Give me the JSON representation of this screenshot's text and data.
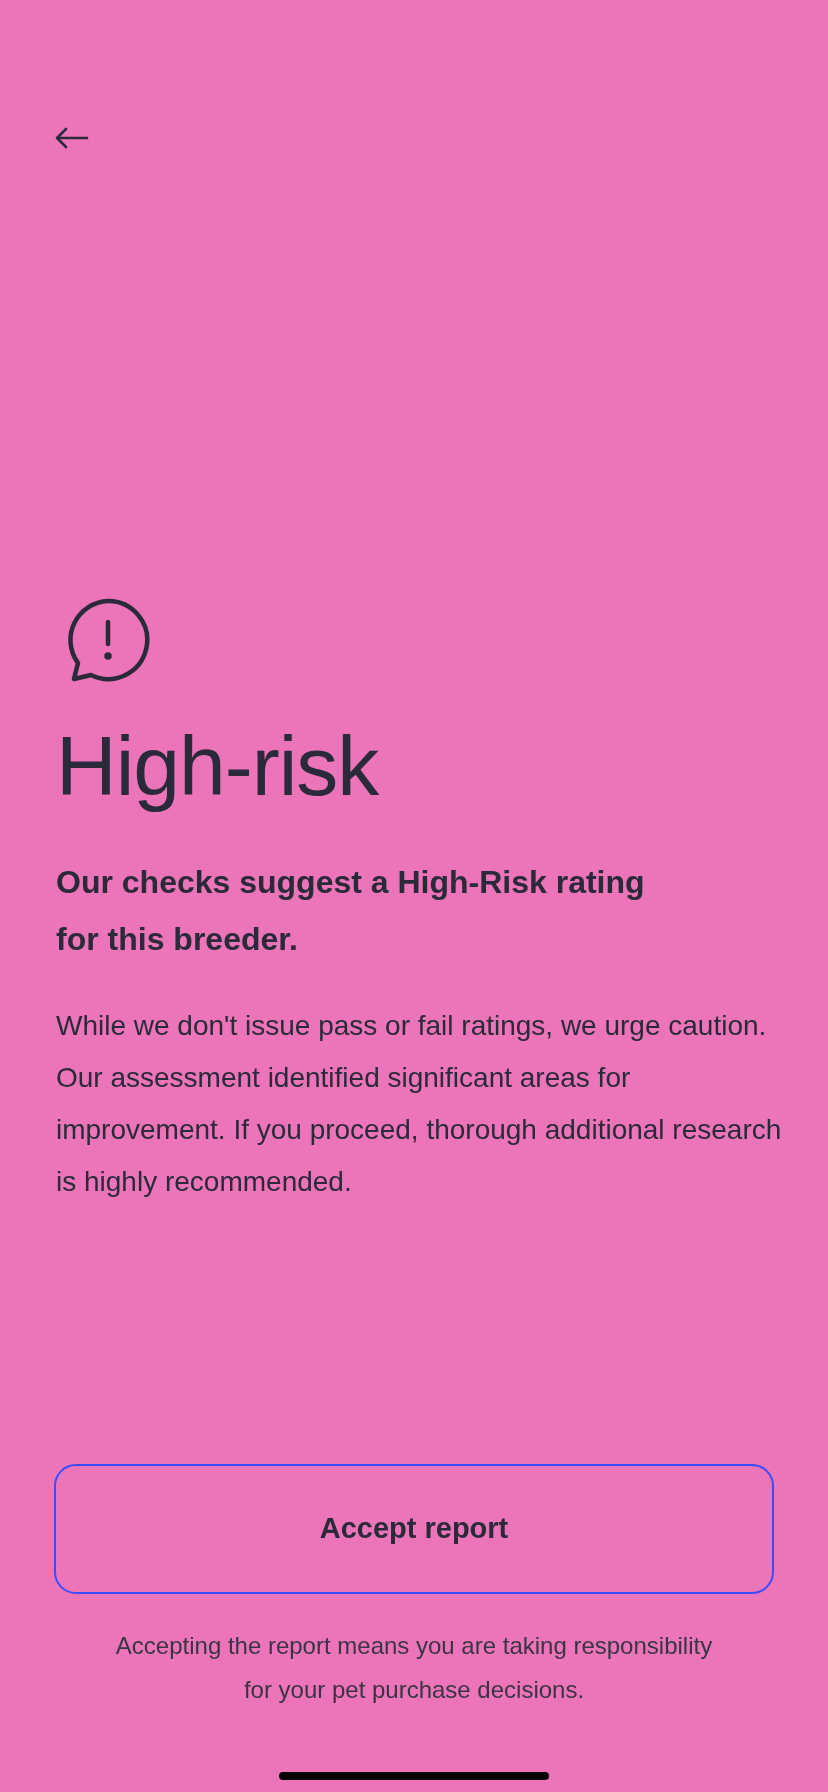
{
  "title": "High-risk",
  "subtitle": "Our checks suggest a High-Risk rating for this breeder.",
  "body": "While we don't issue pass or fail ratings, we urge caution. Our assessment identified significant areas for improvement. If you proceed, thorough additional research is highly recommended.",
  "button": "Accept report",
  "footnote": "Accepting the report means you are taking responsibility for your pet purchase decisions."
}
